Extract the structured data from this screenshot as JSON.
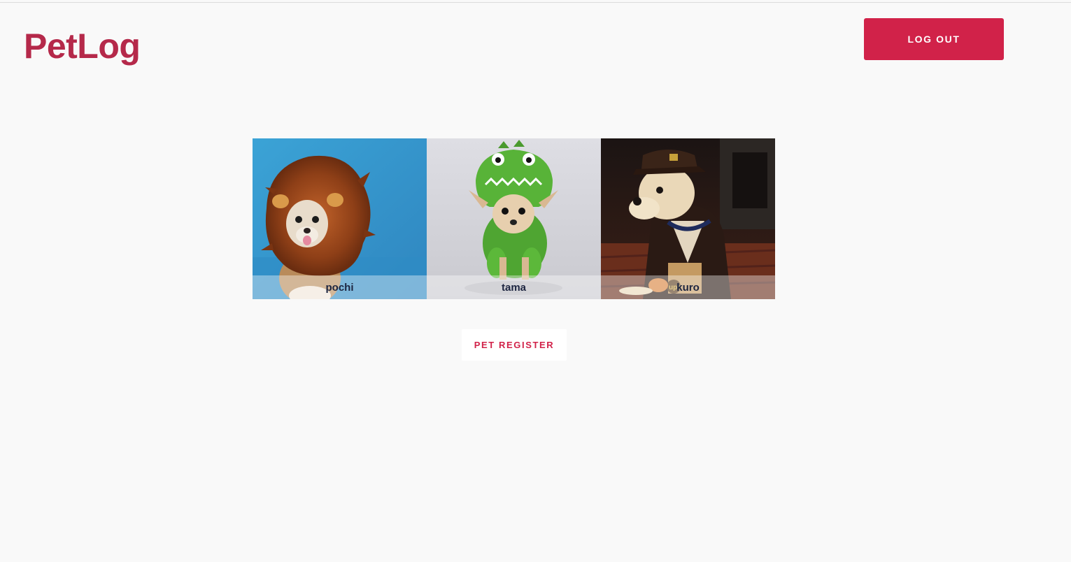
{
  "theme": {
    "brand_color": "#b5294a",
    "accent_color": "#d12249",
    "background": "#f9f9f9"
  },
  "header": {
    "brand": "PetLog",
    "logout_label": "LOG OUT"
  },
  "pets": [
    {
      "name": "pochi",
      "photo": "dog-in-lion-mane-costume"
    },
    {
      "name": "tama",
      "photo": "dog-in-green-dinosaur-costume"
    },
    {
      "name": "kuro",
      "photo": "dog-in-delivery-uniform"
    }
  ],
  "actions": {
    "register_label": "PET REGISTER"
  }
}
